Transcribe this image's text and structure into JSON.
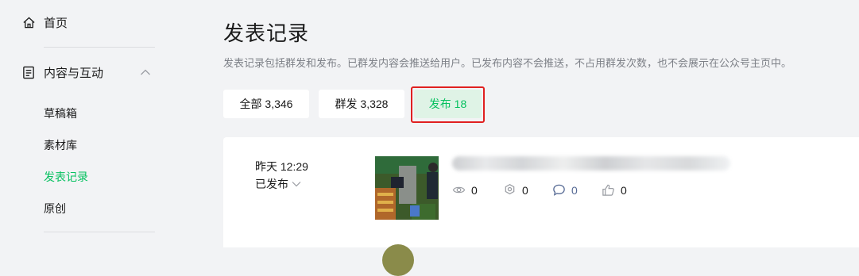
{
  "sidebar": {
    "home_label": "首页",
    "group_label": "内容与互动",
    "sub_items": [
      {
        "label": "草稿箱",
        "active": false
      },
      {
        "label": "素材库",
        "active": false
      },
      {
        "label": "发表记录",
        "active": true
      },
      {
        "label": "原创",
        "active": false
      }
    ]
  },
  "page": {
    "title": "发表记录",
    "description": "发表记录包括群发和发布。已群发内容会推送给用户。已发布内容不会推送，不占用群发次数，也不会展示在公众号主页中。"
  },
  "tabs": [
    {
      "label": "全部 3,346",
      "active": false
    },
    {
      "label": "群发 3,328",
      "active": false
    },
    {
      "label": "发布 18",
      "active": true
    }
  ],
  "record": {
    "time": "昨天 12:29",
    "status": "已发布",
    "stats": {
      "views": "0",
      "shares": "0",
      "comments": "0",
      "likes": "0"
    }
  },
  "colors": {
    "accent": "#07c160",
    "highlight_border": "#e02020",
    "background": "#f2f3f5",
    "comment_icon": "#576b95"
  }
}
